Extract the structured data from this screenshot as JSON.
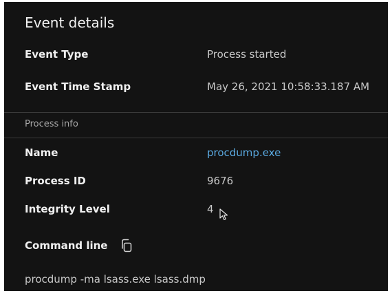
{
  "panel": {
    "title": "Event details"
  },
  "event": {
    "type_label": "Event Type",
    "type_value": "Process started",
    "timestamp_label": "Event Time Stamp",
    "timestamp_value": "May 26, 2021 10:58:33.187 AM"
  },
  "process_info": {
    "section_label": "Process info",
    "name_label": "Name",
    "name_value": "procdump.exe",
    "pid_label": "Process ID",
    "pid_value": "9676",
    "integrity_label": "Integrity Level",
    "integrity_value": "4",
    "command_label": "Command line",
    "command_value": "procdump -ma lsass.exe lsass.dmp"
  },
  "colors": {
    "background": "#131313",
    "link": "#5aa9e0"
  },
  "icons": {
    "copy": "copy-icon",
    "cursor": "mouse-pointer-icon"
  }
}
